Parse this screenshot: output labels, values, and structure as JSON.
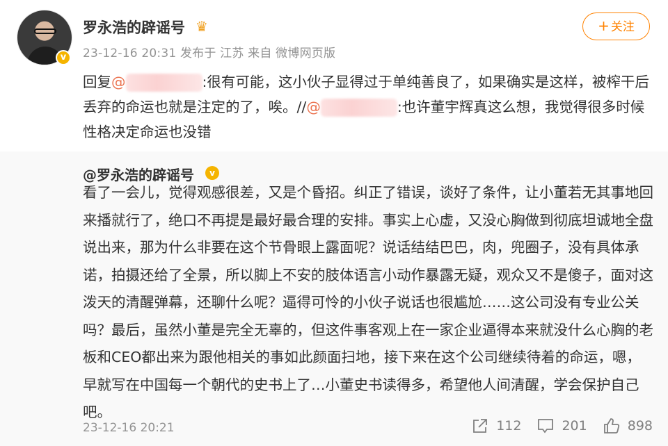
{
  "post": {
    "author": "罗永浩的辟谣号",
    "meta": "23-12-16 20:31  发布于 江苏  来自 微博网页版",
    "follow_label": "关注",
    "follow_plus": "+",
    "verified_mark": "v",
    "text_parts": {
      "reply_prefix": "回复",
      "at1": "@",
      "part1": ":很有可能，这小伙子显得过于单纯善良了，如果确实是这样，被榨干后丢弃的命运也就是注定的了，唉。//",
      "at2": "@",
      "part2": ":也许董宇辉真这么想，我觉得很多时候性格决定命运也没错"
    }
  },
  "repost": {
    "author": "@罗永浩的辟谣号",
    "verified_mark": "v",
    "text": "看了一会儿，觉得观感很差，又是个昏招。纠正了错误，谈好了条件，让小董若无其事地回来播就行了，绝口不再提是最好最合理的安排。事实上心虚，又没心胸做到彻底坦诚地全盘说出来，那为什么非要在这个节骨眼上露面呢？说话结结巴巴，肉，兜圈子，没有具体承诺，拍摄还给了全景，所以脚上不安的肢体语言小动作暴露无疑，观众又不是傻子，面对这泼天的清醒弹幕，还聊什么呢？逼得可怜的小伙子说话也很尴尬……这公司没有专业公关吗？最后，虽然小董是完全无辜的，但这件事客观上在一家企业逼得本来就没什么心胸的老板和CEO都出来为跟他相关的事如此颜面扫地，接下来在这个公司继续待着的命运，嗯，早就写在中国每一个朝代的史书上了…小董史书读得多，希望他人间清醒，学会保护自己吧。",
    "time": "23-12-16 20:21",
    "actions": {
      "share_count": "112",
      "comment_count": "201",
      "like_count": "898"
    }
  },
  "colors": {
    "accent": "#ff8200",
    "mention": "#eb7350",
    "meta_text": "#939393",
    "repost_bg": "#f9f9f9"
  },
  "icons": [
    "verified-badge-icon",
    "crown-icon",
    "share-icon",
    "comment-icon",
    "like-icon"
  ]
}
